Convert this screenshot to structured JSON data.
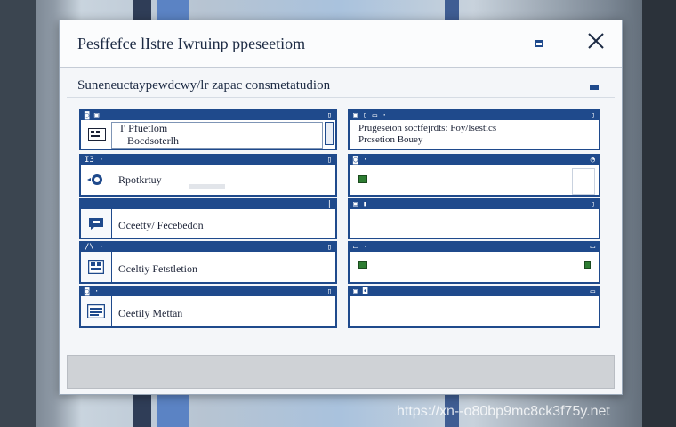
{
  "colors": {
    "accent": "#1f4a8c",
    "panel_bg": "#ffffff",
    "dialog_bg": "#f4f6f9"
  },
  "dialog": {
    "title": "Pesffefce lIstre Iwruinp ppeseetiom",
    "subtitle": "Suneneuctaypewdcwy/lr zapac consmetatudion",
    "close_icon": "close-icon",
    "minimize_icon": "window-icon"
  },
  "left_panels": [
    {
      "label_line1": "I' Pfuetlom",
      "label_line2": "Bocdsoterlh",
      "icon": "grid-icon"
    },
    {
      "label_line1": "Rpotkrtuy",
      "label_line2": "",
      "icon": "refresh-icon"
    },
    {
      "label_line1": "Oceetty/ Fecebedon",
      "label_line2": "",
      "icon": "chat-icon"
    },
    {
      "label_line1": "Oceltiy Fetstletion",
      "label_line2": "",
      "icon": "grid-icon"
    },
    {
      "label_line1": "Oeetily Mettan",
      "label_line2": "",
      "icon": "list-icon"
    }
  ],
  "right_panels": [
    {
      "label_line1": "Prugeseion soctfejrdts: Foy/lsestics",
      "label_line2": "Prcsetion Bouey"
    },
    {
      "label_line1": "",
      "label_line2": ""
    },
    {
      "label_line1": "",
      "label_line2": ""
    },
    {
      "label_line1": "",
      "label_line2": ""
    },
    {
      "label_line1": "",
      "label_line2": ""
    }
  ],
  "watermark": "https://xn--o80bp9mc8ck3f75y.net"
}
